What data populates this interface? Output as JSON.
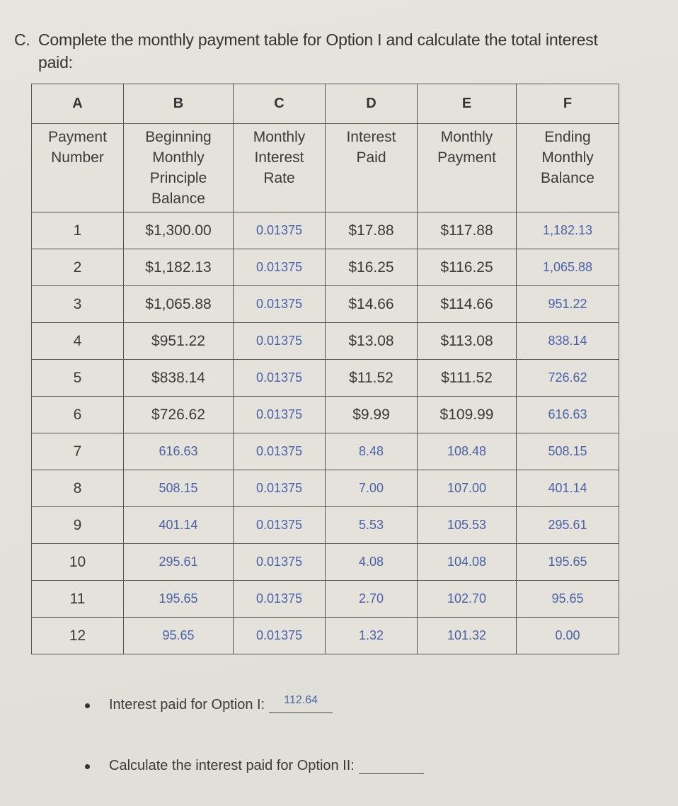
{
  "question": {
    "letter": "C.",
    "line1": "Complete the monthly payment table for Option I and calculate the total interest",
    "line2": "paid:"
  },
  "table": {
    "column_letters": [
      "A",
      "B",
      "C",
      "D",
      "E",
      "F"
    ],
    "column_headers": [
      [
        "Payment",
        "Number"
      ],
      [
        "Beginning",
        "Monthly",
        "Principle",
        "Balance"
      ],
      [
        "Monthly",
        "Interest",
        "Rate"
      ],
      [
        "Interest",
        "Paid"
      ],
      [
        "Monthly",
        "Payment"
      ],
      [
        "Ending",
        "Monthly",
        "Balance"
      ]
    ],
    "rows": [
      {
        "cells": [
          "1",
          "$1,300.00",
          "0.01375",
          "$17.88",
          "$117.88",
          "1,182.13"
        ],
        "handwritten": [
          false,
          false,
          true,
          false,
          false,
          true
        ]
      },
      {
        "cells": [
          "2",
          "$1,182.13",
          "0.01375",
          "$16.25",
          "$116.25",
          "1,065.88"
        ],
        "handwritten": [
          false,
          false,
          true,
          false,
          false,
          true
        ]
      },
      {
        "cells": [
          "3",
          "$1,065.88",
          "0.01375",
          "$14.66",
          "$114.66",
          "951.22"
        ],
        "handwritten": [
          false,
          false,
          true,
          false,
          false,
          true
        ]
      },
      {
        "cells": [
          "4",
          "$951.22",
          "0.01375",
          "$13.08",
          "$113.08",
          "838.14"
        ],
        "handwritten": [
          false,
          false,
          true,
          false,
          false,
          true
        ]
      },
      {
        "cells": [
          "5",
          "$838.14",
          "0.01375",
          "$11.52",
          "$111.52",
          "726.62"
        ],
        "handwritten": [
          false,
          false,
          true,
          false,
          false,
          true
        ]
      },
      {
        "cells": [
          "6",
          "$726.62",
          "0.01375",
          "$9.99",
          "$109.99",
          "616.63"
        ],
        "handwritten": [
          false,
          false,
          true,
          false,
          false,
          true
        ]
      },
      {
        "cells": [
          "7",
          "616.63",
          "0.01375",
          "8.48",
          "108.48",
          "508.15"
        ],
        "handwritten": [
          false,
          true,
          true,
          true,
          true,
          true
        ]
      },
      {
        "cells": [
          "8",
          "508.15",
          "0.01375",
          "7.00",
          "107.00",
          "401.14"
        ],
        "handwritten": [
          false,
          true,
          true,
          true,
          true,
          true
        ]
      },
      {
        "cells": [
          "9",
          "401.14",
          "0.01375",
          "5.53",
          "105.53",
          "295.61"
        ],
        "handwritten": [
          false,
          true,
          true,
          true,
          true,
          true
        ]
      },
      {
        "cells": [
          "10",
          "295.61",
          "0.01375",
          "4.08",
          "104.08",
          "195.65"
        ],
        "handwritten": [
          false,
          true,
          true,
          true,
          true,
          true
        ]
      },
      {
        "cells": [
          "11",
          "195.65",
          "0.01375",
          "2.70",
          "102.70",
          "95.65"
        ],
        "handwritten": [
          false,
          true,
          true,
          true,
          true,
          true
        ]
      },
      {
        "cells": [
          "12",
          "95.65",
          "0.01375",
          "1.32",
          "101.32",
          "0.00"
        ],
        "handwritten": [
          false,
          true,
          true,
          true,
          true,
          true
        ]
      }
    ]
  },
  "answers": [
    {
      "label": "Interest paid for Option I:",
      "value": "112.64"
    },
    {
      "label": "Calculate the interest paid for Option II:",
      "value": ""
    }
  ],
  "colors": {
    "printed_text": "#3a3a3a",
    "handwritten_text": "#4a62a8",
    "paper": "#e4e2da"
  }
}
